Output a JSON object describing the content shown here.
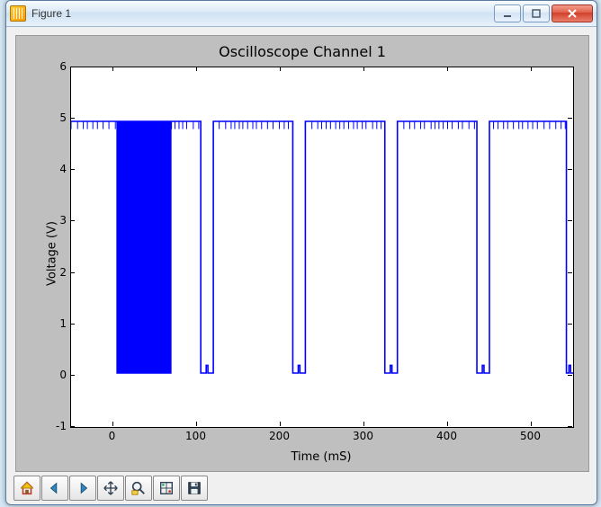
{
  "window": {
    "title": "Figure 1"
  },
  "chart_data": {
    "type": "line",
    "title": "Oscilloscope Channel 1",
    "xlabel": "Time (mS)",
    "ylabel": "Voltage (V)",
    "xlim": [
      -50,
      550
    ],
    "ylim": [
      -1,
      6
    ],
    "xticks": [
      0,
      100,
      200,
      300,
      400,
      500
    ],
    "yticks": [
      -1,
      0,
      1,
      2,
      3,
      4,
      5,
      6
    ],
    "high_level": 4.95,
    "low_level": 0.05,
    "description": "Digital-like square wave, nominally at ~5V high and ~0V low, with a dense burst of rapid transitions between roughly t=5ms and t=70ms, followed by a periodic pattern: long high segments (~90ms) separated by short low pulses (~15ms) centered roughly at t≈112, 222, 332, 442 ms, with a final drop near t≈545ms.",
    "burst": {
      "start": 5,
      "end": 70,
      "transitions": 80
    },
    "low_pulses": [
      {
        "start": 105,
        "end": 120
      },
      {
        "start": 215,
        "end": 230
      },
      {
        "start": 325,
        "end": 340
      },
      {
        "start": 435,
        "end": 450
      },
      {
        "start": 542,
        "end": 550
      }
    ]
  },
  "toolbar": {
    "buttons": [
      "home",
      "back",
      "forward",
      "pan",
      "zoom",
      "subplot-config",
      "save"
    ]
  }
}
